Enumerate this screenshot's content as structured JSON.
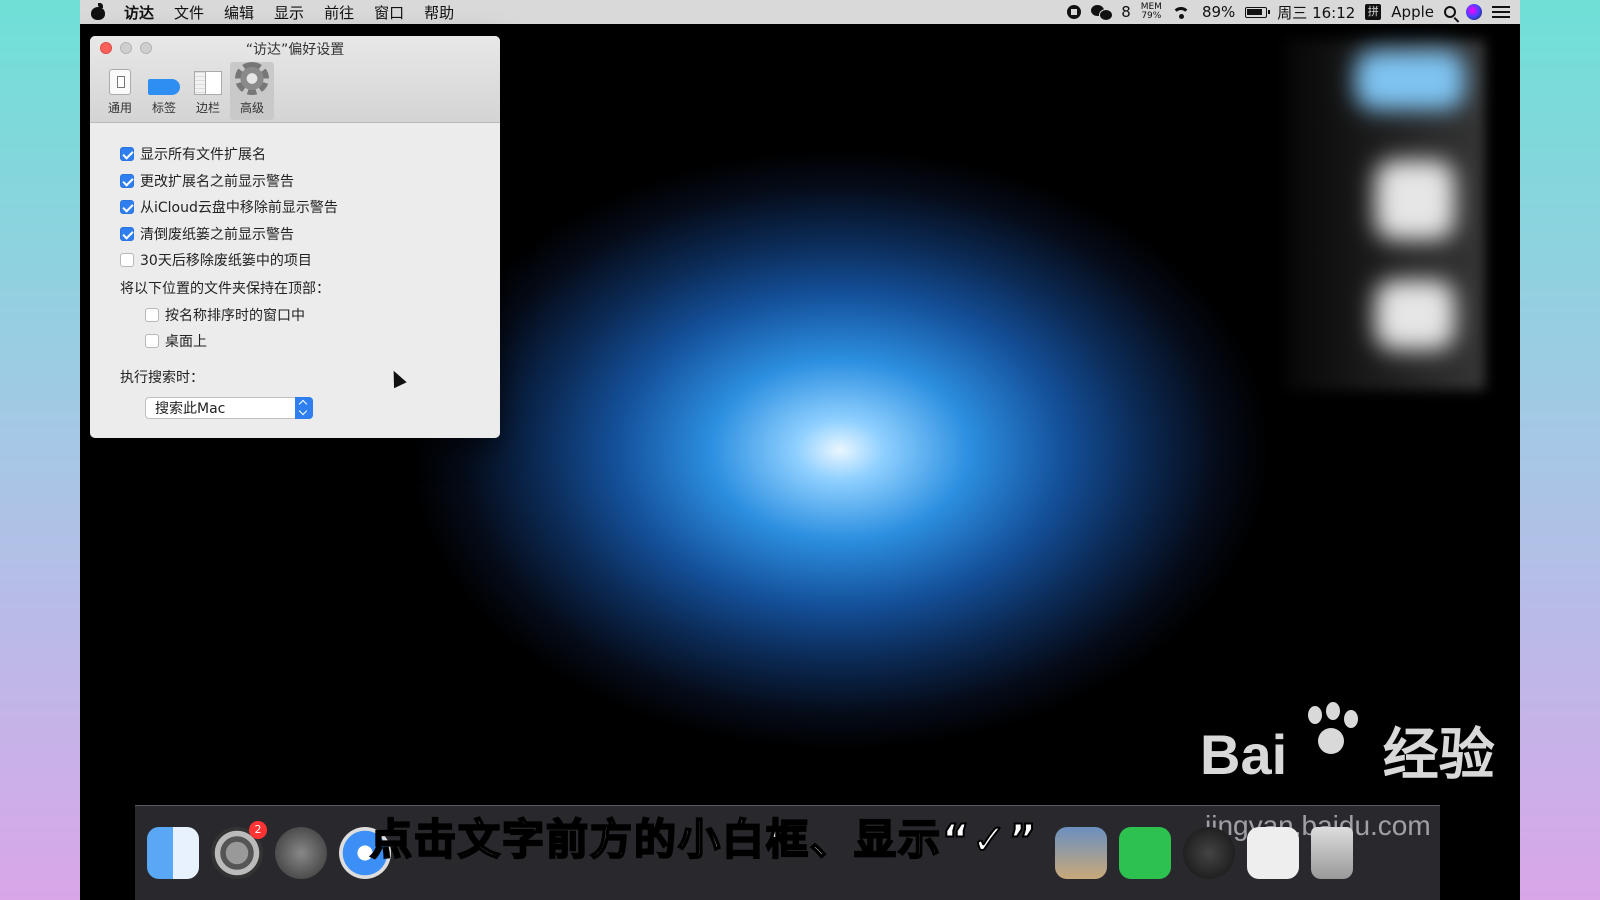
{
  "menubar": {
    "items": [
      "访达",
      "文件",
      "编辑",
      "显示",
      "前往",
      "窗口",
      "帮助"
    ],
    "wechat_count": "8",
    "mem_label": "MEM",
    "mem_value": "79%",
    "battery": "89%",
    "clock": "周三 16:12",
    "ime": "拼",
    "user": "Apple"
  },
  "window": {
    "title": "“访达”偏好设置",
    "tabs": [
      {
        "label": "通用",
        "icon": "switch-icon"
      },
      {
        "label": "标签",
        "icon": "tag-icon"
      },
      {
        "label": "边栏",
        "icon": "sidebar-icon"
      },
      {
        "label": "高级",
        "icon": "gear-icon"
      }
    ],
    "active_tab": "高级",
    "options": [
      {
        "label": "显示所有文件扩展名",
        "checked": true
      },
      {
        "label": "更改扩展名之前显示警告",
        "checked": true
      },
      {
        "label": "从iCloud云盘中移除前显示警告",
        "checked": true
      },
      {
        "label": "清倒废纸篓之前显示警告",
        "checked": true
      },
      {
        "label": "30天后移除废纸篓中的项目",
        "checked": false
      }
    ],
    "keep_top_label": "将以下位置的文件夹保持在顶部：",
    "keep_top_options": [
      {
        "label": "按名称排序时的窗口中",
        "checked": false
      },
      {
        "label": "桌面上",
        "checked": false
      }
    ],
    "search_label": "执行搜索时：",
    "search_value": "搜索此Mac"
  },
  "dock": {
    "syspref_badge": "2"
  },
  "caption": "点击文字前方的小白框、显示“✓”",
  "watermark": {
    "brand": "Bai",
    "brand_tail": "经验",
    "url": "jingyan.baidu.com"
  },
  "colors": {
    "accent": "#2f7ff0",
    "close": "#fc605b"
  }
}
